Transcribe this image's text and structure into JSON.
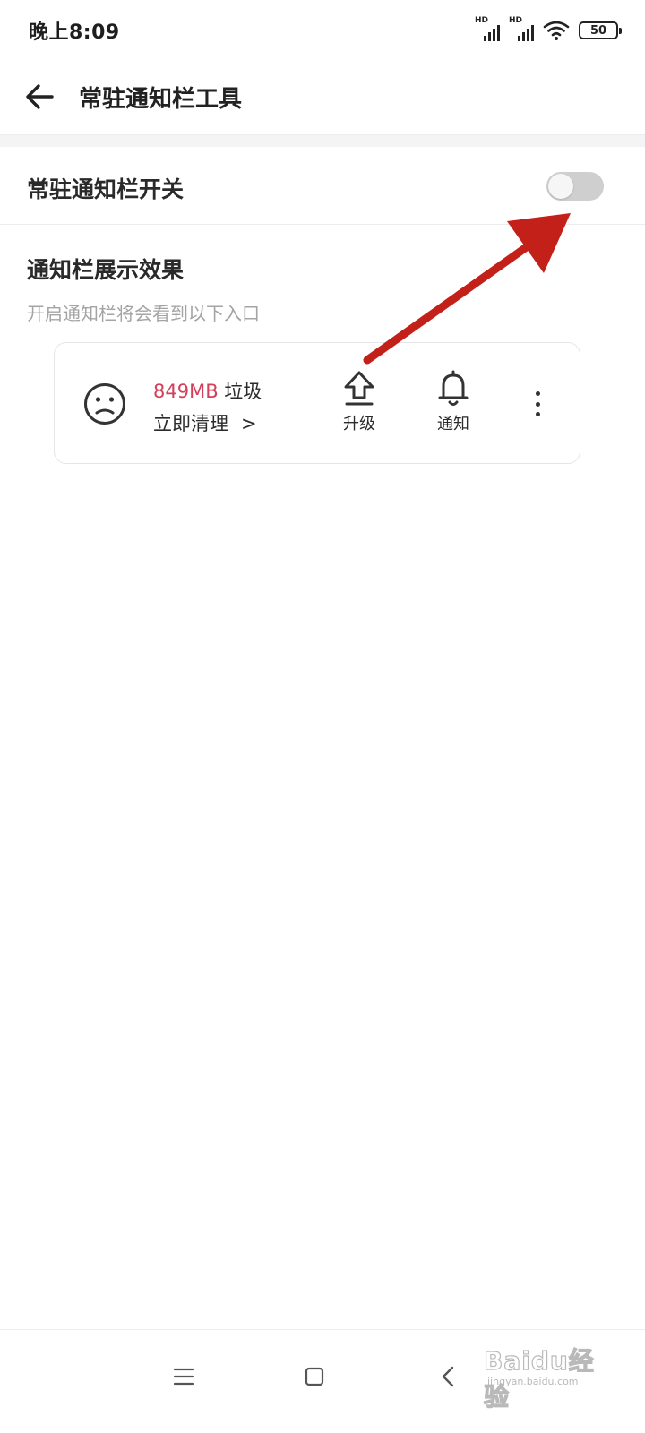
{
  "status_bar": {
    "time": "晚上8:09",
    "signal_label_1": "HD",
    "signal_label_2": "HD",
    "battery_level": "50",
    "icons": [
      "signal-hd-icon",
      "signal-hd-icon",
      "wifi-icon",
      "battery-icon"
    ]
  },
  "header": {
    "title": "常驻通知栏工具",
    "back_icon": "arrow-left-icon"
  },
  "toggle": {
    "label": "常驻通知栏开关",
    "state": "off",
    "track_color": "#cfcfcf"
  },
  "preview": {
    "title": "通知栏展示效果",
    "description": "开启通知栏将会看到以下入口",
    "face_icon": "sad-face-icon",
    "junk_size": "849MB",
    "junk_word": "垃圾",
    "clean_label": "立即清理",
    "clean_chevron": ">",
    "actions": [
      {
        "icon": "upgrade-arrow-icon",
        "label": "升级"
      },
      {
        "icon": "bell-icon",
        "label": "通知"
      }
    ],
    "more_icon": "more-vertical-icon",
    "accent_color": "#d2405b"
  },
  "annotation": {
    "icon": "red-arrow-icon",
    "color": "#c4201a"
  },
  "nav_bar": {
    "icons": [
      "menu-icon",
      "home-icon",
      "back-icon"
    ]
  },
  "watermark": {
    "text": "Baidu经验",
    "url": "jingyan.baidu.com"
  }
}
